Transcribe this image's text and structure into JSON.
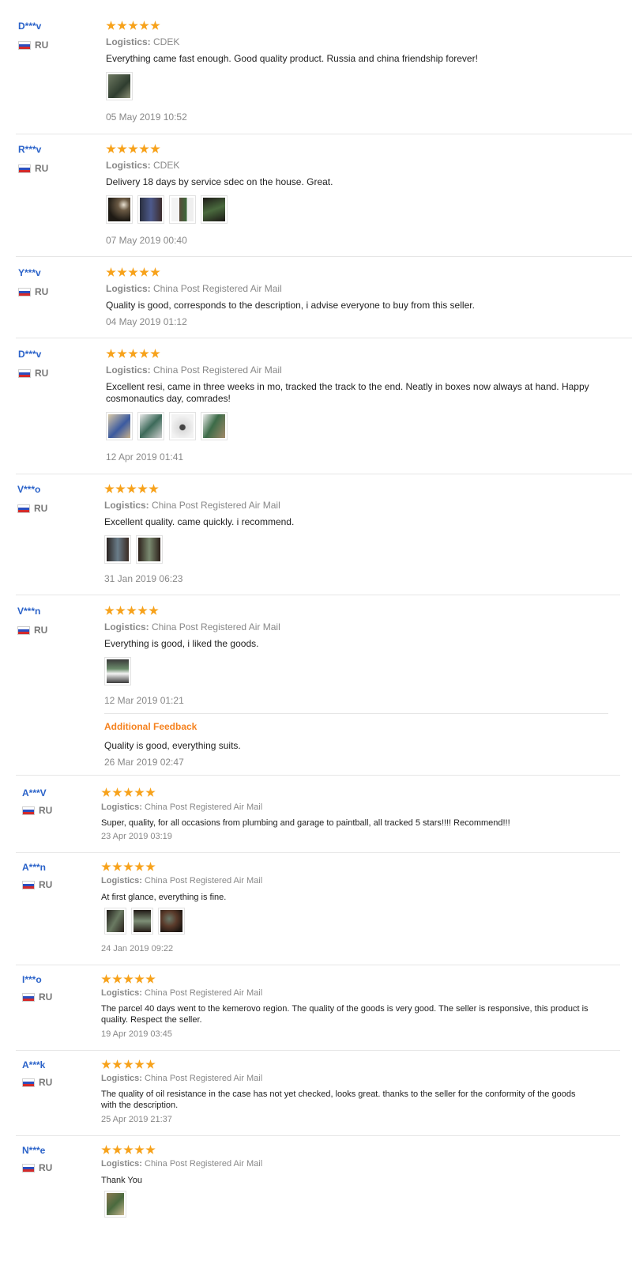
{
  "reviews": [
    {
      "user": "D***v",
      "country": "RU",
      "stars": 5,
      "logistics_label": "Logistics:",
      "logistics": "CDEK",
      "text": "Everything came fast enough. Good quality product. Russia and china friendship forever!",
      "date": "05 May 2019 10:52",
      "photos": 1
    },
    {
      "user": "R***v",
      "country": "RU",
      "stars": 5,
      "logistics_label": "Logistics:",
      "logistics": "CDEK",
      "text": "Delivery 18 days by service sdec on the house. Great.",
      "date": "07 May 2019 00:40",
      "photos": 4
    },
    {
      "user": "Y***v",
      "country": "RU",
      "stars": 5,
      "logistics_label": "Logistics:",
      "logistics": "China Post Registered Air Mail",
      "text": "Quality is good, corresponds to the description, i advise everyone to buy from this seller.",
      "date": "04 May 2019 01:12",
      "photos": 0
    },
    {
      "user": "D***v",
      "country": "RU",
      "stars": 5,
      "logistics_label": "Logistics:",
      "logistics": "China Post Registered Air Mail",
      "text_line1": "Excellent resi, came in three weeks in mo, tracked the track to the end. Neatly in boxes now always at hand. Happy",
      "text_line2": "cosmonautics day, comrades!",
      "date": "12 Apr 2019 01:41",
      "photos": 4
    },
    {
      "user": "V***o",
      "country": "RU",
      "stars": 5,
      "logistics_label": "Logistics:",
      "logistics": "China Post Registered Air Mail",
      "text": "Excellent quality. came quickly. i recommend.",
      "date": "31 Jan 2019 06:23",
      "photos": 2
    },
    {
      "user": "V***n",
      "country": "RU",
      "stars": 5,
      "logistics_label": "Logistics:",
      "logistics": "China Post Registered Air Mail",
      "text": "Everything is good, i liked the goods.",
      "date": "12 Mar 2019 01:21",
      "photos": 1,
      "additional_title": "Additional Feedback",
      "additional_text": "Quality is good, everything suits.",
      "additional_date": "26 Mar 2019 02:47"
    },
    {
      "user": "A***V",
      "country": "RU",
      "stars": 5,
      "logistics_label": "Logistics:",
      "logistics": "China Post Registered Air Mail",
      "text": "Super, quality, for all occasions from plumbing and garage to paintball, all tracked 5 stars!!!! Recommend!!!",
      "date": "23 Apr 2019 03:19",
      "photos": 0
    },
    {
      "user": "A***n",
      "country": "RU",
      "stars": 5,
      "logistics_label": "Logistics:",
      "logistics": "China Post Registered Air Mail",
      "text": "At first glance, everything is fine.",
      "date": "24 Jan 2019 09:22",
      "photos": 3
    },
    {
      "user": "I***o",
      "country": "RU",
      "stars": 5,
      "logistics_label": "Logistics:",
      "logistics": "China Post Registered Air Mail",
      "text_line1": "The parcel 40 days went to the kemerovo region. The quality of the goods is very good. The seller is responsive, this product is",
      "text_line2": "quality. Respect the seller.",
      "date": "19 Apr 2019 03:45",
      "photos": 0
    },
    {
      "user": "A***k",
      "country": "RU",
      "stars": 5,
      "logistics_label": "Logistics:",
      "logistics": "China Post Registered Air Mail",
      "text_line1": "The quality of oil resistance in the case has not yet checked, looks great. thanks to the seller for the conformity of the goods",
      "text_line2": "with the description.",
      "date": "25 Apr 2019 21:37",
      "photos": 0
    },
    {
      "user": "N***e",
      "country": "RU",
      "stars": 5,
      "logistics_label": "Logistics:",
      "logistics": "China Post Registered Air Mail",
      "text": "Thank You",
      "date": "",
      "photos": 1
    }
  ],
  "colors": {
    "username": "#2a62c9",
    "star": "#f7a21b",
    "muted": "#888888",
    "accent": "#f5821f"
  }
}
